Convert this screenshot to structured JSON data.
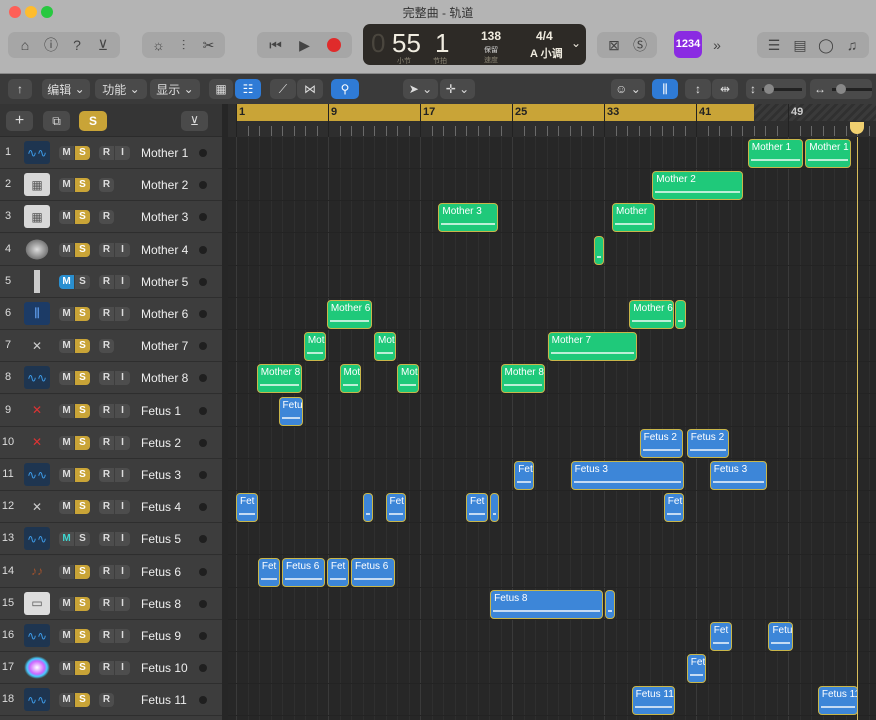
{
  "window": {
    "title": "完整曲 - 轨道"
  },
  "lcd": {
    "bar": "55",
    "bar_label": "小节",
    "beat": "1",
    "beat_label": "节拍",
    "tempo": "138",
    "tempo_mode": "保留",
    "tempo_label": "速度",
    "signature": "4/4",
    "key": "A 小调"
  },
  "count_in": "1234",
  "menus": {
    "edit": "编辑",
    "functions": "功能",
    "view": "显示"
  },
  "header": {
    "solo": "S",
    "add": "+"
  },
  "ruler": {
    "marks": [
      "1",
      "9",
      "17",
      "25",
      "33",
      "41",
      "49"
    ],
    "cycle_start_bar": 1,
    "cycle_end_bar": 46,
    "playhead_bar": 55
  },
  "colors": {
    "mother": "#1fc97a",
    "fetus": "#3d86d8",
    "cycle": "#c9a437",
    "solo": "#c9a437",
    "mute_active": "#2a8fd0"
  },
  "tracks": [
    {
      "num": "1",
      "name": "Mother 1",
      "icon": "audio-wave",
      "mute": false,
      "solo": true,
      "input": true,
      "regions": [
        {
          "name": "Mother 1",
          "start": 45.5,
          "len": 4.8
        },
        {
          "name": "Mother 1",
          "start": 50.5,
          "len": 4
        }
      ]
    },
    {
      "num": "2",
      "name": "Mother 2",
      "icon": "drum-machine",
      "mute": false,
      "solo": true,
      "input": false,
      "regions": [
        {
          "name": "Mother 2",
          "start": 37.2,
          "len": 7.9
        }
      ]
    },
    {
      "num": "3",
      "name": "Mother 3",
      "icon": "drum-machine",
      "mute": false,
      "solo": true,
      "input": false,
      "regions": [
        {
          "name": "Mother 3",
          "start": 18.6,
          "len": 5.2
        },
        {
          "name": "Mother",
          "start": 33.7,
          "len": 3.7
        }
      ]
    },
    {
      "num": "4",
      "name": "Mother 4",
      "icon": "drum",
      "mute": false,
      "solo": true,
      "input": true,
      "regions": [
        {
          "name": "",
          "start": 32.1,
          "len": 0.9
        }
      ]
    },
    {
      "num": "5",
      "name": "Mother 5",
      "icon": "microphone",
      "mute": true,
      "solo": false,
      "input": true,
      "regions": []
    },
    {
      "num": "6",
      "name": "Mother 6",
      "icon": "sampler",
      "mute": false,
      "solo": true,
      "input": true,
      "regions": [
        {
          "name": "Mother 6",
          "start": 8.9,
          "len": 3.9
        },
        {
          "name": "Mother 6",
          "start": 35.2,
          "len": 3.9
        },
        {
          "name": "",
          "start": 39.2,
          "len": 0.9
        }
      ]
    },
    {
      "num": "7",
      "name": "Mother 7",
      "icon": "keyboard-stand",
      "mute": false,
      "solo": true,
      "input": false,
      "regions": [
        {
          "name": "Mot",
          "start": 6.9,
          "len": 1.9
        },
        {
          "name": "Mot",
          "start": 13,
          "len": 1.9
        },
        {
          "name": "Mother 7",
          "start": 28.1,
          "len": 7.8
        }
      ]
    },
    {
      "num": "8",
      "name": "Mother 8",
      "icon": "audio-wave",
      "mute": false,
      "solo": true,
      "input": true,
      "regions": [
        {
          "name": "Mother 8",
          "start": 2.8,
          "len": 3.9
        },
        {
          "name": "Mot",
          "start": 10,
          "len": 1.9
        },
        {
          "name": "Mot",
          "start": 15,
          "len": 1.9
        },
        {
          "name": "Mother 8",
          "start": 24,
          "len": 3.9
        }
      ]
    },
    {
      "num": "9",
      "name": "Fetus 1",
      "icon": "red-keyboard",
      "mute": false,
      "solo": true,
      "input": true,
      "regions": [
        {
          "name": "Fetu",
          "start": 4.7,
          "len": 2.1
        }
      ]
    },
    {
      "num": "10",
      "name": "Fetus 2",
      "icon": "red-keyboard",
      "mute": false,
      "solo": true,
      "input": true,
      "regions": [
        {
          "name": "Fetus 2",
          "start": 36.1,
          "len": 3.8
        },
        {
          "name": "Fetus 2",
          "start": 40.2,
          "len": 3.7
        }
      ]
    },
    {
      "num": "11",
      "name": "Fetus 3",
      "icon": "audio-wave",
      "mute": false,
      "solo": true,
      "input": true,
      "regions": [
        {
          "name": "Fet",
          "start": 25.2,
          "len": 1.7
        },
        {
          "name": "Fetus 3",
          "start": 30.1,
          "len": 9.9
        },
        {
          "name": "Fetus 3",
          "start": 42.2,
          "len": 5
        }
      ]
    },
    {
      "num": "12",
      "name": "Fetus 4",
      "icon": "keyboard-stand",
      "mute": false,
      "solo": true,
      "input": true,
      "regions": [
        {
          "name": "Fet",
          "start": 1,
          "len": 1.9
        },
        {
          "name": "",
          "start": 12,
          "len": 0.9
        },
        {
          "name": "Fet",
          "start": 14,
          "len": 1.8
        },
        {
          "name": "Fet",
          "start": 21,
          "len": 1.9
        },
        {
          "name": "",
          "start": 23.1,
          "len": 0.8
        },
        {
          "name": "Fet",
          "start": 38.2,
          "len": 1.8
        }
      ]
    },
    {
      "num": "13",
      "name": "Fetus 5",
      "icon": "audio-wave",
      "mute": "teal",
      "solo": false,
      "input": true,
      "regions": []
    },
    {
      "num": "14",
      "name": "Fetus 6",
      "icon": "strings",
      "mute": false,
      "solo": true,
      "input": true,
      "regions": [
        {
          "name": "Fet",
          "start": 2.9,
          "len": 1.9
        },
        {
          "name": "Fetus 6",
          "start": 5,
          "len": 3.7
        },
        {
          "name": "Fet",
          "start": 8.9,
          "len": 1.9
        },
        {
          "name": "Fetus 6",
          "start": 11,
          "len": 3.8
        }
      ]
    },
    {
      "num": "15",
      "name": "Fetus 8",
      "icon": "synth",
      "mute": false,
      "solo": true,
      "input": true,
      "regions": [
        {
          "name": "Fetus 8",
          "start": 23.1,
          "len": 9.8
        },
        {
          "name": "",
          "start": 33.1,
          "len": 0.9
        }
      ]
    },
    {
      "num": "16",
      "name": "Fetus 9",
      "icon": "audio-wave",
      "mute": false,
      "solo": true,
      "input": true,
      "regions": [
        {
          "name": "Fet",
          "start": 42.2,
          "len": 1.9
        },
        {
          "name": "Fetu",
          "start": 47.3,
          "len": 2.1
        }
      ]
    },
    {
      "num": "17",
      "name": "Fetus 10",
      "icon": "sparkle",
      "mute": false,
      "solo": true,
      "input": true,
      "regions": [
        {
          "name": "Fet",
          "start": 40.2,
          "len": 1.7
        }
      ]
    },
    {
      "num": "18",
      "name": "Fetus 11",
      "icon": "audio-wave",
      "mute": false,
      "solo": true,
      "input": false,
      "regions": [
        {
          "name": "Fetus 11",
          "start": 35.4,
          "len": 3.8
        },
        {
          "name": "Fetus 11",
          "start": 51.6,
          "len": 3.5
        }
      ]
    }
  ],
  "btn_labels": {
    "m": "M",
    "s": "S",
    "r": "R",
    "i": "I"
  }
}
